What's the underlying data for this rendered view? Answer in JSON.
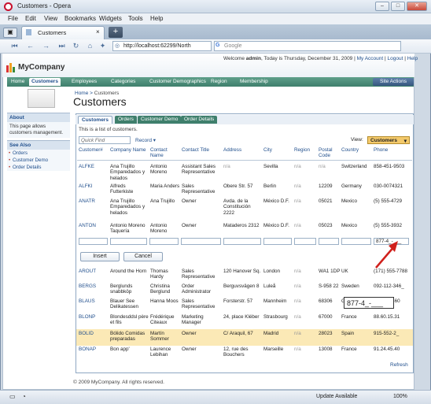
{
  "window": {
    "title": "Customers - Opera"
  },
  "menu": [
    "File",
    "Edit",
    "View",
    "Bookmarks",
    "Widgets",
    "Tools",
    "Help"
  ],
  "browser": {
    "tab": "Customers",
    "address": "http://localhost:62299/North",
    "search": "Google"
  },
  "header": {
    "welcome_prefix": "Welcome",
    "user": "admin",
    "date": ", Today is Thursday, December 31, 2009",
    "links": [
      "My Account",
      "Logout",
      "Help"
    ],
    "brand": "MyCompany"
  },
  "nav": [
    "Home",
    "Customers",
    "Employees",
    "Categories",
    "Customer Demographics",
    "Region",
    "Membership"
  ],
  "site_actions": "Site Actions",
  "sidebar": {
    "about_title": "About",
    "about_text": "This page allows customers management.",
    "see_also_title": "See Also",
    "links": [
      "Orders",
      "Customer Demo",
      "Order Details"
    ]
  },
  "breadcrumb": {
    "home": "Home",
    "sep": ">",
    "current": "Customers"
  },
  "page_title": "Customers",
  "view_tabs": [
    "Customers",
    "Orders",
    "Customer Demo",
    "Order Details"
  ],
  "description": "This is a list of customers.",
  "quick_find": "Quick Find",
  "record": "Record",
  "view_label": "View:",
  "view_value": "Customers",
  "columns": [
    "Customer#",
    "Company Name",
    "Contact Name",
    "Contact Title",
    "Address",
    "City",
    "Region",
    "Postal Code",
    "Country",
    "Phone"
  ],
  "rows_top": [
    [
      "ALFKE",
      "Ana Trujillo Emparedados y helados",
      "Antonio Moreno",
      "Assistant Sales Representative",
      "n/a",
      "Sevilla",
      "n/a",
      "n/a",
      "Switzerland",
      "858-451-9503"
    ],
    [
      "ALFKI",
      "Alfreds Futterkiste",
      "Maria Anders",
      "Sales Representative",
      "Obere Str. 57",
      "Berlin",
      "n/a",
      "12209",
      "Germany",
      "030-0074321"
    ],
    [
      "ANATR",
      "Ana Trujillo Emparedados y helados",
      "Ana Trujillo",
      "Owner",
      "Avda. de la Constitución 2222",
      "México D.F.",
      "n/a",
      "05021",
      "Mexico",
      "(5) 555-4729"
    ],
    [
      "ANTON",
      "Antonio Moreno Taquería",
      "Antonio Moreno",
      "Owner",
      "Mataderos 2312",
      "México D.F.",
      "n/a",
      "05023",
      "Mexico",
      "(5) 555-3932"
    ]
  ],
  "insert_phone": "877-4_-___",
  "buttons": {
    "insert": "Insert",
    "cancel": "Cancel"
  },
  "rows_bottom": [
    [
      "AROUT",
      "Around the Horn",
      "Thomas Hardy",
      "Sales Representative",
      "120 Hanover Sq.",
      "London",
      "n/a",
      "WA1 1DP",
      "UK",
      "(171) 555-7788"
    ],
    [
      "BERGS",
      "Berglunds snabbköp",
      "Christina Berglund",
      "Order Administrator",
      "Berguvsvägen 8",
      "Luleå",
      "n/a",
      "S-958 22",
      "Sweden",
      "092-112-346_"
    ],
    [
      "BLAUS",
      "Blauer See Delikatessen",
      "Hanna Moos",
      "Sales Representative",
      "Forsterstr. 57",
      "Mannheim",
      "n/a",
      "68306",
      "Germany",
      "0621-08460"
    ],
    [
      "BLONP",
      "Blondesddsl père et fils",
      "Frédérique Citeaux",
      "Marketing Manager",
      "24, place Kléber",
      "Strasbourg",
      "n/a",
      "67000",
      "France",
      "88.60.15.31"
    ],
    [
      "BOLID",
      "Bólido Comidas preparadas",
      "Martín Sommer",
      "Owner",
      "C/ Araquil, 67",
      "Madrid",
      "n/a",
      "28023",
      "Spain",
      "915-552-2_"
    ],
    [
      "BONAP",
      "Bon app'",
      "Laurence Lebihan",
      "Owner",
      "12, rue des Bouchers",
      "Marseille",
      "n/a",
      "13008",
      "France",
      "91.24.45.40"
    ]
  ],
  "refresh": "Refresh",
  "tooltip": "877-4_-___",
  "footer": "© 2009 MyCompany. All rights reserved.",
  "status": {
    "update": "Update Available",
    "zoom": "100%"
  }
}
